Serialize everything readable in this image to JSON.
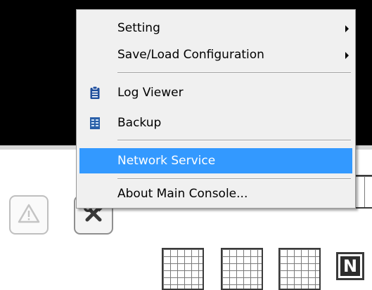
{
  "menu": {
    "items": [
      {
        "label": "Setting",
        "submenu": true
      },
      {
        "label": "Save/Load Configuration",
        "submenu": true
      },
      {
        "label": "Log Viewer",
        "icon": "clipboard-icon"
      },
      {
        "label": "Backup",
        "icon": "backup-icon"
      },
      {
        "label": "Network Service",
        "highlighted": true
      },
      {
        "label": "About Main Console..."
      }
    ]
  },
  "toolbar": {
    "buttons": [
      {
        "icon": "warning-icon"
      },
      {
        "icon": "tools-icon"
      }
    ]
  },
  "tiles": {
    "n_label": "N"
  },
  "colors": {
    "highlight": "#3399ff",
    "menu_bg": "#f0f0f0",
    "layout_accent": "#3da6d6"
  }
}
